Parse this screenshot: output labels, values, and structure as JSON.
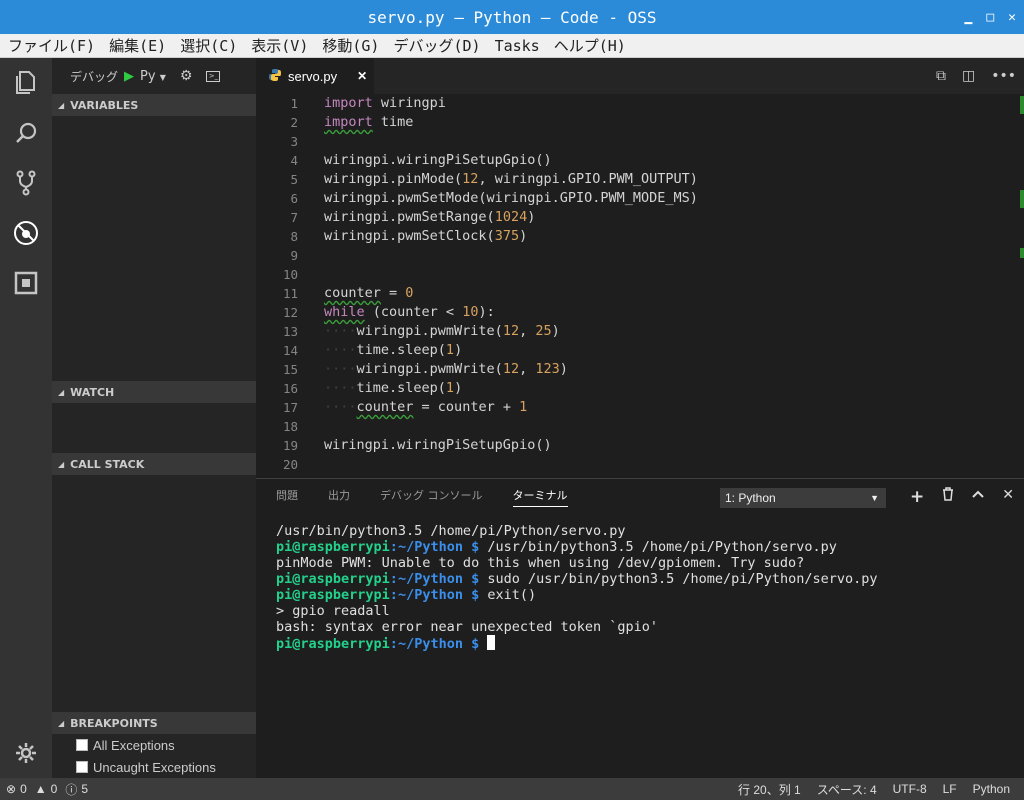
{
  "window": {
    "title": "servo.py — Python — Code - OSS",
    "min": "▁",
    "max": "□",
    "close": "✕"
  },
  "menu": [
    "ファイル(F)",
    "編集(E)",
    "選択(C)",
    "表示(V)",
    "移動(G)",
    "デバッグ(D)",
    "Tasks",
    "ヘルプ(H)"
  ],
  "activity": [
    "files-icon",
    "search-icon",
    "source-control-icon",
    "debug-icon",
    "extensions-icon",
    "settings-icon"
  ],
  "debug": {
    "label": "デバッグ",
    "config": "Py"
  },
  "sidebar": {
    "variables": "VARIABLES",
    "watch": "WATCH",
    "callstack": "CALL STACK",
    "breakpoints": "BREAKPOINTS",
    "bp_items": [
      "All Exceptions",
      "Uncaught Exceptions"
    ]
  },
  "tab": {
    "name": "servo.py",
    "close": "✕"
  },
  "code": {
    "l1_kw": "import",
    "l1_rest": " wiringpi",
    "l2_kw": "import",
    "l2_rest": " time",
    "l4": "wiringpi.wiringPiSetupGpio()",
    "l5a": "wiringpi.pinMode(",
    "l5n": "12",
    "l5b": ", wiringpi.GPIO.PWM_OUTPUT)",
    "l6": "wiringpi.pwmSetMode(wiringpi.GPIO.PWM_MODE_MS)",
    "l7a": "wiringpi.pwmSetRange(",
    "l7n": "1024",
    "l7b": ")",
    "l8a": "wiringpi.pwmSetClock(",
    "l8n": "375",
    "l8b": ")",
    "l11a": "counter",
    "l11b": " = ",
    "l11n": "0",
    "l12kw": "while",
    "l12a": " (counter < ",
    "l12n": "10",
    "l12b": "):",
    "l13a": "wiringpi.pwmWrite(",
    "l13n1": "12",
    "l13c": ", ",
    "l13n2": "25",
    "l13b": ")",
    "l14a": "time.sleep(",
    "l14n": "1",
    "l14b": ")",
    "l15a": "wiringpi.pwmWrite(",
    "l15n1": "12",
    "l15c": ", ",
    "l15n2": "123",
    "l15b": ")",
    "l16a": "time.sleep(",
    "l16n": "1",
    "l16b": ")",
    "l17a": "counter",
    "l17b": " = counter + ",
    "l17n": "1",
    "l19": "wiringpi.wiringPiSetupGpio()",
    "dots": "····"
  },
  "line_numbers": [
    "1",
    "2",
    "3",
    "4",
    "5",
    "6",
    "7",
    "8",
    "9",
    "10",
    "11",
    "12",
    "13",
    "14",
    "15",
    "16",
    "17",
    "18",
    "19",
    "20"
  ],
  "panel": {
    "tabs": [
      "問題",
      "出力",
      "デバッグ コンソール",
      "ターミナル"
    ],
    "terminal_select": "1: Python",
    "actions": [
      "+",
      "🗑",
      "∧",
      "✕"
    ]
  },
  "terminal": {
    "l1": "/usr/bin/python3.5 /home/pi/Python/servo.py",
    "user": "pi@raspberrypi",
    "colon": ":",
    "path": "~/Python $",
    "l2cmd": " /usr/bin/python3.5 /home/pi/Python/servo.py",
    "l3": "pinMode PWM: Unable to do this when using /dev/gpiomem. Try sudo?",
    "l4cmd": " sudo /usr/bin/python3.5 /home/pi/Python/servo.py",
    "l5cmd": " exit()",
    "l6": "> gpio readall",
    "l7": "bash: syntax error near unexpected token `gpio'"
  },
  "status": {
    "errors": "0",
    "warnings": "0",
    "infos": "5",
    "position": "行 20、列 1",
    "spaces": "スペース: 4",
    "encoding": "UTF-8",
    "eol": "LF",
    "language": "Python"
  }
}
